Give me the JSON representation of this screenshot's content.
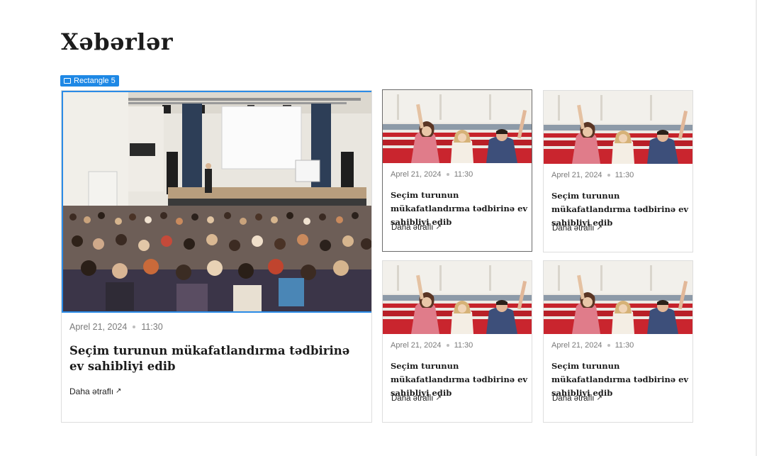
{
  "page": {
    "title": "Xəbərlər"
  },
  "selection": {
    "label": "Rectangle 5"
  },
  "featured": {
    "date": "Aprel 21, 2024",
    "time": "11:30",
    "headline": "Seçim turunun mükafatlandırma tədbirinə ev sahibliyi edib",
    "more_label": "Daha ətraflı",
    "image_icon": "conference-hall-photo"
  },
  "cards": [
    {
      "date": "Aprel 21, 2024",
      "time": "11:30",
      "headline": "Seçim turunun mükafatlandırma tədbirinə ev sahibliyi edib",
      "more_label": "Daha ətraflı"
    },
    {
      "date": "Aprel 21, 2024",
      "time": "11:30",
      "headline": "Seçim turunun mükafatlandırma tədbirinə ev sahibliyi edib",
      "more_label": "Daha ətraflı"
    },
    {
      "date": "Aprel 21, 2024",
      "time": "11:30",
      "headline": "Seçim turunun mükafatlandırma tədbirinə ev sahibliyi edib",
      "more_label": "Daha ətraflı"
    },
    {
      "date": "Aprel 21, 2024",
      "time": "11:30",
      "headline": "Seçim turunun mükafatlandırma tədbirinə ev sahibliyi edib",
      "more_label": "Daha ətraflı"
    }
  ],
  "colors": {
    "selection": "#1e88e5",
    "seats": "#c8202b",
    "text": "#1b1b1b",
    "meta": "#7a7a7a"
  }
}
